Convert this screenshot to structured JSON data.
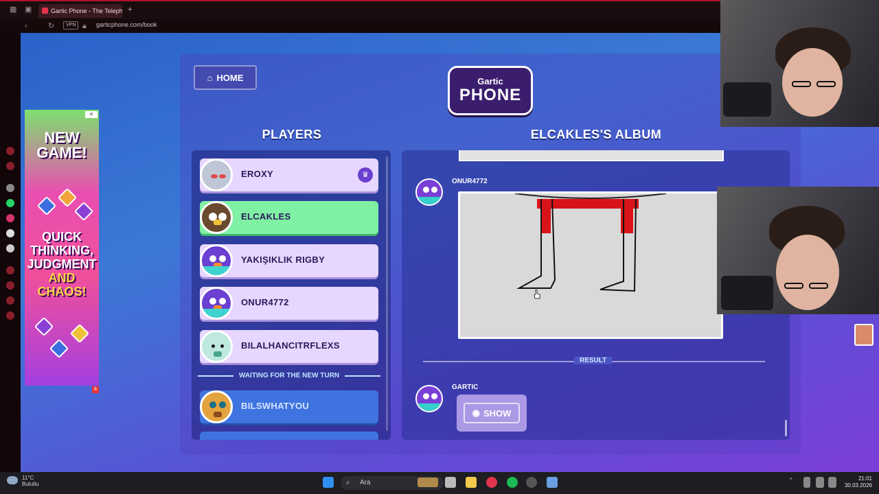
{
  "browser": {
    "tab_title": "Gartic Phone - The Teleph",
    "new_tab": "+",
    "vpn": "VPN",
    "url": "garticphone.com/book"
  },
  "game": {
    "home_label": "HOME",
    "logo_line1": "Gartic",
    "logo_line2": "PHONE",
    "players_heading": "PLAYERS",
    "album_heading": "ELCAKLES'S ALBUM",
    "players": [
      {
        "name": "EROXY",
        "host": true
      },
      {
        "name": "ELCAKLES",
        "current": true
      },
      {
        "name": "YAKIŞIKLIK RIGBY"
      },
      {
        "name": "ONUR4772"
      },
      {
        "name": "BILALHANCITRFLEXS"
      }
    ],
    "waiting_label": "WAITING FOR THE NEW TURN",
    "waiting_players": [
      {
        "name": "BILSWHATYOU"
      }
    ],
    "album": {
      "drawing_author": "ONUR4772",
      "result_label": "RESULT",
      "result_author": "GARTIC",
      "show_label": "SHOW"
    }
  },
  "ad": {
    "line1": "NEW",
    "line2": "GAME!",
    "line3": "QUICK",
    "line4": "THINKING,",
    "line5": "JUDGMENT",
    "line6": "AND",
    "line7": "CHAOS!",
    "close": "✕",
    "badge": "A"
  },
  "taskbar": {
    "temperature": "11°C",
    "weather": "Bulutlu",
    "search_placeholder": "Ara",
    "time": "21:01",
    "date": "30.03.2026"
  },
  "colors": {
    "accent": "#b0122a",
    "current_player": "#7ff0a4",
    "player_card": "#e7d6ff"
  }
}
